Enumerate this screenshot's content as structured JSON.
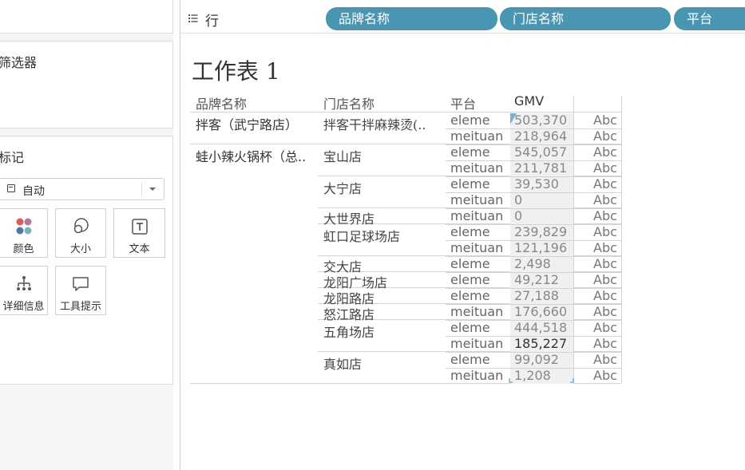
{
  "left_panel": {
    "filters_title": "筛选器",
    "marks_title": "标记",
    "mark_type": "自动",
    "buttons": {
      "color": "颜色",
      "size": "大小",
      "text": "文本",
      "detail": "详细信息",
      "tooltip": "工具提示"
    }
  },
  "rows_shelf": {
    "label": "行",
    "pills": [
      "品牌名称",
      "门店名称",
      "平台"
    ]
  },
  "worksheet": {
    "title": "工作表 1",
    "headers": {
      "brand": "品牌名称",
      "store": "门店名称",
      "platform": "平台",
      "gmv": "GMV"
    },
    "brands": [
      "拌客（武宁路店）",
      "蛙小辣火锅杯（总.."
    ],
    "stores": [
      "拌客干拌麻辣烫(..",
      "宝山店",
      "大宁店",
      "大世界店",
      "虹口足球场店",
      "交大店",
      "龙阳广场店",
      "龙阳路店",
      "怒江路店",
      "五角场店",
      "真如店"
    ],
    "rows": [
      {
        "platform": "eleme",
        "gmv": "503,370",
        "abc": "Abc"
      },
      {
        "platform": "meituan",
        "gmv": "218,964",
        "abc": "Abc"
      },
      {
        "platform": "eleme",
        "gmv": "545,057",
        "abc": "Abc"
      },
      {
        "platform": "meituan",
        "gmv": "211,781",
        "abc": "Abc"
      },
      {
        "platform": "eleme",
        "gmv": "39,530",
        "abc": "Abc"
      },
      {
        "platform": "meituan",
        "gmv": "0",
        "abc": "Abc"
      },
      {
        "platform": "meituan",
        "gmv": "0",
        "abc": "Abc"
      },
      {
        "platform": "eleme",
        "gmv": "239,829",
        "abc": "Abc"
      },
      {
        "platform": "meituan",
        "gmv": "121,196",
        "abc": "Abc"
      },
      {
        "platform": "eleme",
        "gmv": "2,498",
        "abc": "Abc"
      },
      {
        "platform": "eleme",
        "gmv": "49,212",
        "abc": "Abc"
      },
      {
        "platform": "eleme",
        "gmv": "27,188",
        "abc": "Abc"
      },
      {
        "platform": "meituan",
        "gmv": "176,660",
        "abc": "Abc"
      },
      {
        "platform": "eleme",
        "gmv": "444,518",
        "abc": "Abc"
      },
      {
        "platform": "meituan",
        "gmv": "185,227",
        "abc": "Abc"
      },
      {
        "platform": "eleme",
        "gmv": "99,092",
        "abc": "Abc"
      },
      {
        "platform": "meituan",
        "gmv": "1,208",
        "abc": "Abc"
      }
    ]
  },
  "colors": {
    "pill": "#4996b2",
    "color_dots": [
      "#e1575a",
      "#b07aa1",
      "#4e79a7",
      "#76b7b2"
    ]
  }
}
